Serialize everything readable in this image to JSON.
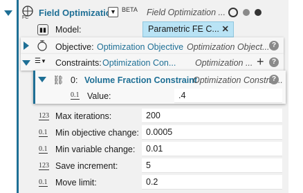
{
  "header": {
    "title": "Field Optimization",
    "beta": "BETA",
    "subtitle": "Field Optimization ..."
  },
  "model": {
    "label": "Model:",
    "value": "Parametric FE C...",
    "clear": "✕"
  },
  "objective": {
    "label": "Objective:",
    "value": "Optimization Objective",
    "subtitle": "Optimization Object...",
    "help": "?"
  },
  "constraints": {
    "label": "Constraints:",
    "value": "Optimization Con...",
    "subtitle": "Optimization ...",
    "add": "+",
    "help": "?"
  },
  "constraint0": {
    "index": "0:",
    "title": "Volume Fraction Constraint",
    "subtitle": "Optimization Constrai...",
    "help": "?",
    "value_label": "Value:",
    "value": ".4",
    "icon_text": "0.1"
  },
  "params": [
    {
      "icon": "123",
      "label": "Max iterations:",
      "value": "200"
    },
    {
      "icon": "0.1",
      "label": "Min objective change:",
      "value": "0.0005"
    },
    {
      "icon": "0.1",
      "label": "Min variable change:",
      "value": "0.01"
    },
    {
      "icon": "123",
      "label": "Save increment:",
      "value": "5"
    },
    {
      "icon": "0.1",
      "label": "Move limit:",
      "value": "0.2"
    }
  ],
  "colors": {
    "accent": "#1e6f95",
    "panel": "#f2f2f2",
    "model_value_bg": "#b9e3f5"
  }
}
